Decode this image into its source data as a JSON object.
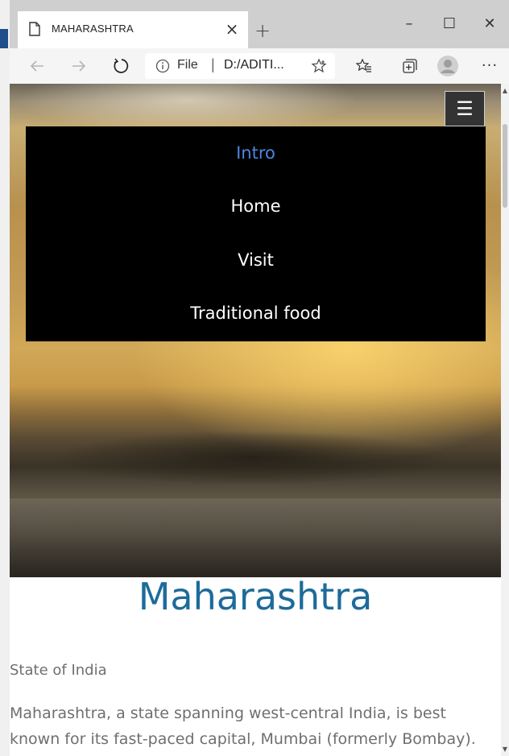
{
  "browser": {
    "tab_title": "MAHARASHTRA",
    "tab_close_label": "×",
    "new_tab_label": "+",
    "window_controls": {
      "minimize": "–",
      "maximize": "☐",
      "close": "✕"
    },
    "address": {
      "scheme_label": "File",
      "separator": "|",
      "url": "D:/ADITI..."
    },
    "icons": {
      "back": "arrow-left-icon",
      "forward": "arrow-right-icon",
      "refresh": "refresh-icon",
      "info": "info-icon",
      "favorite": "star-icon",
      "favorites_bar": "favorites-icon",
      "collections": "collections-icon",
      "profile": "profile-avatar-icon",
      "more": "ellipsis-icon"
    },
    "more_label": "···"
  },
  "page": {
    "menu_toggle_label": "☰",
    "nav": [
      {
        "label": "Intro",
        "active": true
      },
      {
        "label": "Home",
        "active": false
      },
      {
        "label": "Visit",
        "active": false
      },
      {
        "label": "Traditional food",
        "active": false
      }
    ],
    "title": "Maharashtra",
    "subtitle": "State of India",
    "intro": "Maharashtra, a state spanning west-central India, is best known for its fast-paced capital, Mumbai (formerly Bombay).",
    "colors": {
      "title": "#1d6b9a",
      "nav_active": "#4c86dd",
      "nav_bg": "#000000",
      "text": "#6f6f6f"
    }
  }
}
